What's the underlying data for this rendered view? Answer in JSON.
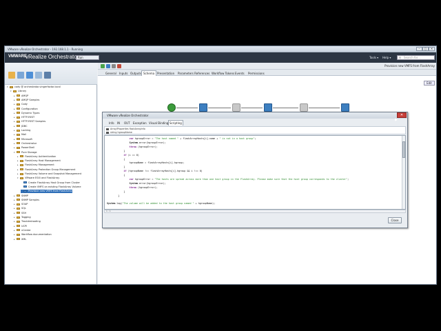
{
  "window": {
    "title": "VMware vRealize Orchestrator - 192.168.1.1 - Running",
    "controls": [
      "–",
      "□",
      "✕"
    ]
  },
  "header": {
    "brand_vm": "VMWARE",
    "brand_app": "vRealize Orchestrator",
    "mode": "Run",
    "links": [
      "Tools ▾",
      "Help ▾"
    ],
    "search_placeholder": "Search for..."
  },
  "workflow_title": "Provision new VMFS from FlashArray",
  "tabs": [
    "General",
    "Inputs",
    "Outputs",
    "Schema",
    "Presentation",
    "Parameters References",
    "Workflow Tokens",
    "Events",
    "Permissions"
  ],
  "active_tab": "Schema",
  "tree": [
    {
      "label": "cody @ orchestrator.vingerfactor.local",
      "indent": 0,
      "exp": "▾"
    },
    {
      "label": "Library",
      "indent": 1,
      "exp": "▾"
    },
    {
      "label": "AMQP",
      "indent": 2,
      "exp": "▸"
    },
    {
      "label": "AMQP Samples",
      "indent": 2,
      "exp": "▸"
    },
    {
      "label": "Cody",
      "indent": 2,
      "exp": "▸"
    },
    {
      "label": "Configuration",
      "indent": 2,
      "exp": "▸"
    },
    {
      "label": "Dynamic Types",
      "indent": 2,
      "exp": "▸"
    },
    {
      "label": "HTTP-REST",
      "indent": 2,
      "exp": "▸"
    },
    {
      "label": "HTTP-REST Samples",
      "indent": 2,
      "exp": "▸"
    },
    {
      "label": "JDBC",
      "indent": 2,
      "exp": "▸"
    },
    {
      "label": "Locking",
      "indent": 2,
      "exp": "▸"
    },
    {
      "label": "Mail",
      "indent": 2,
      "exp": "▸"
    },
    {
      "label": "Microsoft",
      "indent": 2,
      "exp": "▸"
    },
    {
      "label": "Orchestrator",
      "indent": 2,
      "exp": "▸"
    },
    {
      "label": "PowerShell",
      "indent": 2,
      "exp": "▸"
    },
    {
      "label": "Pure Storage",
      "indent": 2,
      "exp": "▾"
    },
    {
      "label": "FlashArray Authentication",
      "indent": 3,
      "exp": "▸"
    },
    {
      "label": "FlashArray Host Management",
      "indent": 3,
      "exp": "▸"
    },
    {
      "label": "FlashArray Management",
      "indent": 3,
      "exp": "▸"
    },
    {
      "label": "FlashArray Protection Group Management",
      "indent": 3,
      "exp": "▸"
    },
    {
      "label": "FlashArray Volume and Snapshot Management",
      "indent": 3,
      "exp": "▸"
    },
    {
      "label": "VMware ESXi and FlashArray",
      "indent": 3,
      "exp": "▾"
    },
    {
      "label": "Create FlashArray Host Group from Cluster",
      "indent": 4,
      "exp": ""
    },
    {
      "label": "Create VMFS on existing FlashArray Volume",
      "indent": 4,
      "exp": ""
    },
    {
      "label": "Provision new VMFS from FlashArray",
      "indent": 4,
      "exp": "",
      "selected": true
    },
    {
      "label": "SNMP",
      "indent": 2,
      "exp": "▸"
    },
    {
      "label": "SNMP Samples",
      "indent": 2,
      "exp": "▸"
    },
    {
      "label": "SOAP",
      "indent": 2,
      "exp": "▸"
    },
    {
      "label": "SQL",
      "indent": 2,
      "exp": "▸"
    },
    {
      "label": "SSH",
      "indent": 2,
      "exp": "▸"
    },
    {
      "label": "Tagging",
      "indent": 2,
      "exp": "▸"
    },
    {
      "label": "Troubleshooting",
      "indent": 2,
      "exp": "▸"
    },
    {
      "label": "UCPI",
      "indent": 2,
      "exp": "▸"
    },
    {
      "label": "vCenter",
      "indent": 2,
      "exp": "▸"
    },
    {
      "label": "Workflow documentation",
      "indent": 2,
      "exp": "▸"
    },
    {
      "label": "XML",
      "indent": 2,
      "exp": "▸"
    }
  ],
  "canvas": {
    "button": "Edit",
    "node_labels": [
      "",
      "",
      "",
      "",
      "",
      "",
      ""
    ]
  },
  "dialog": {
    "title": "VMware vRealize Orchestrator",
    "close": "✕",
    "tabs": [
      "Info",
      "IN",
      "OUT",
      "Exception",
      "Visual Binding",
      "Scripting"
    ],
    "active_tab": "Scripting",
    "params": [
      "Array/Properties flashArrayInfo",
      "string hgroupName"
    ],
    "code": [
      "                var hgroupError = \"The host named \" + flashArrayHosts[i].name + \" is not in a host group\";",
      "                System.error(hgroupError);",
      "                throw (hgroupError);",
      "            }",
      "            if (i == 0)",
      "            {",
      "                hgroupName = flashArrayHosts[i].hgroup;",
      "            }",
      "            if (hgroupName !== flashArrayHosts[i].hgroup && i !== 0)",
      "            {",
      "                var hgroupError = \"The hosts are spread across more than one host group in the FlashArray. Please make sure that the host group corresponds to the cluster\";",
      "                System.error(hgroupError);",
      "                throw (hgroupError);",
      "            }",
      "        }",
      "",
      "System.log(\"The volume will be added to the host group named \" + hgroupName);"
    ],
    "position": "1 : 1",
    "ok_label": "Close"
  }
}
